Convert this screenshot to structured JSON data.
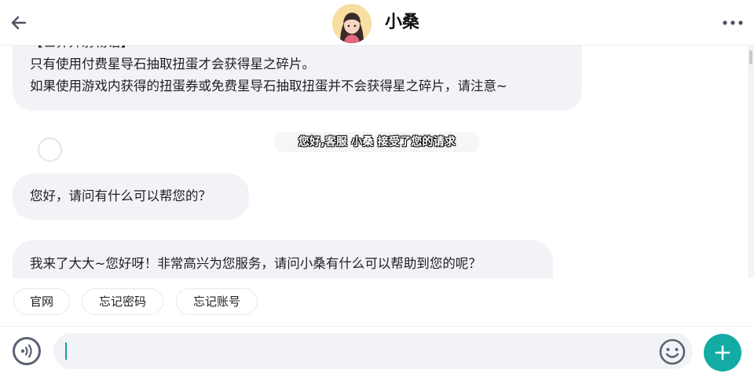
{
  "header": {
    "title": "小桑",
    "back_icon": "arrow-left-icon",
    "more_icon": "more-horizontal-icon",
    "avatar_icon": "agent-avatar"
  },
  "chat": {
    "messages": [
      {
        "role": "agent",
        "lines": [
          "【世界异射物语】",
          "只有使用付费星导石抽取扭蛋才会获得星之碎片。",
          "如果使用游戏内获得的扭蛋券或免费星导石抽取扭蛋并不会获得星之碎片，请注意~"
        ]
      },
      {
        "role": "system",
        "text": "您好,客服 小桑 接受了您的请求"
      },
      {
        "role": "agent",
        "text": "您好，请问有什么可以帮您的？"
      },
      {
        "role": "agent",
        "text": "我来了大大~您好呀！非常高兴为您服务，请问小桑有什么可以帮助到您的呢？"
      }
    ]
  },
  "quick_replies": [
    "官网",
    "忘记密码",
    "忘记账号"
  ],
  "input": {
    "value": "",
    "voice_icon": "voice-icon",
    "emoji_icon": "emoji-icon",
    "plus_icon": "plus-icon"
  },
  "colors": {
    "accent": "#12aca5",
    "bubble": "#f1f3f7"
  }
}
